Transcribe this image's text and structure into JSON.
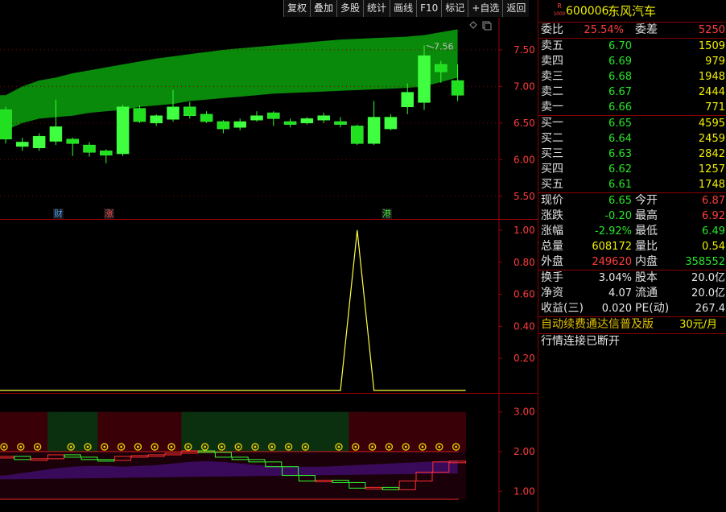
{
  "toolbar": {
    "buttons": [
      "复权",
      "叠加",
      "多股",
      "统计",
      "画线",
      "F10",
      "标记",
      "+自选",
      "返回"
    ]
  },
  "stock": {
    "badge_top": "R",
    "badge_bottom": "1000",
    "code": "600006",
    "name": "东风汽车"
  },
  "quote": {
    "weibi_label": "委比",
    "weibi": "25.54%",
    "weicha_label": "委差",
    "weicha": "5250",
    "asks": [
      {
        "label": "卖五",
        "price": "6.70",
        "vol": "1509"
      },
      {
        "label": "卖四",
        "price": "6.69",
        "vol": "979"
      },
      {
        "label": "卖三",
        "price": "6.68",
        "vol": "1948"
      },
      {
        "label": "卖二",
        "price": "6.67",
        "vol": "2444"
      },
      {
        "label": "卖一",
        "price": "6.66",
        "vol": "771"
      }
    ],
    "bids": [
      {
        "label": "买一",
        "price": "6.65",
        "vol": "4595"
      },
      {
        "label": "买二",
        "price": "6.64",
        "vol": "2459"
      },
      {
        "label": "买三",
        "price": "6.63",
        "vol": "2842"
      },
      {
        "label": "买四",
        "price": "6.62",
        "vol": "1257"
      },
      {
        "label": "买五",
        "price": "6.61",
        "vol": "1748"
      }
    ],
    "stats": [
      {
        "l1": "现价",
        "v1": "6.65",
        "c1": "green",
        "l2": "今开",
        "v2": "6.87",
        "c2": "red"
      },
      {
        "l1": "涨跌",
        "v1": "-0.20",
        "c1": "green",
        "l2": "最高",
        "v2": "6.92",
        "c2": "red"
      },
      {
        "l1": "涨幅",
        "v1": "-2.92%",
        "c1": "green",
        "l2": "最低",
        "v2": "6.49",
        "c2": "green"
      },
      {
        "l1": "总量",
        "v1": "608172",
        "c1": "yellow",
        "l2": "量比",
        "v2": "0.54",
        "c2": "yellow"
      },
      {
        "l1": "外盘",
        "v1": "249620",
        "c1": "red",
        "l2": "内盘",
        "v2": "358552",
        "c2": "green"
      }
    ],
    "finance": [
      {
        "l1": "换手",
        "v1": "3.04%",
        "l2": "股本",
        "v2": "20.0亿"
      },
      {
        "l1": "净资",
        "v1": "4.07",
        "l2": "流通",
        "v2": "20.0亿"
      },
      {
        "l1": "收益(三)",
        "v1": "0.020",
        "l2": "PE(动)",
        "v2": "267.4"
      }
    ],
    "promo_text": "自动续费通达信普及版",
    "promo_price": "30元/月",
    "status": "行情连接已断开"
  },
  "chart_tags": [
    {
      "text": "财",
      "color": "#4aa0ff"
    },
    {
      "text": "涨",
      "color": "#ff5050"
    },
    {
      "text": "港",
      "color": "#40e040"
    }
  ],
  "chart_data": [
    {
      "type": "candlestick",
      "title": "",
      "ylim": [
        5.3,
        7.85
      ],
      "yticks": [
        "7.50",
        "7.00",
        "6.50",
        "6.00",
        "5.50"
      ],
      "annotation": "7.56",
      "candles": [
        {
          "o": 6.68,
          "c": 6.28,
          "h": 6.72,
          "l": 6.22
        },
        {
          "o": 6.18,
          "c": 6.24,
          "h": 6.3,
          "l": 6.12
        },
        {
          "o": 6.16,
          "c": 6.32,
          "h": 6.36,
          "l": 6.12
        },
        {
          "o": 6.25,
          "c": 6.45,
          "h": 6.82,
          "l": 6.2
        },
        {
          "o": 6.28,
          "c": 6.22,
          "h": 6.3,
          "l": 6.05
        },
        {
          "o": 6.2,
          "c": 6.1,
          "h": 6.24,
          "l": 6.04
        },
        {
          "o": 6.12,
          "c": 6.06,
          "h": 6.14,
          "l": 5.95
        },
        {
          "o": 6.08,
          "c": 6.72,
          "h": 6.75,
          "l": 6.05
        },
        {
          "o": 6.7,
          "c": 6.52,
          "h": 6.74,
          "l": 6.5
        },
        {
          "o": 6.5,
          "c": 6.6,
          "h": 6.62,
          "l": 6.46
        },
        {
          "o": 6.55,
          "c": 6.72,
          "h": 6.95,
          "l": 6.52
        },
        {
          "o": 6.72,
          "c": 6.6,
          "h": 6.79,
          "l": 6.56
        },
        {
          "o": 6.62,
          "c": 6.52,
          "h": 6.66,
          "l": 6.5
        },
        {
          "o": 6.52,
          "c": 6.42,
          "h": 6.54,
          "l": 6.36
        },
        {
          "o": 6.44,
          "c": 6.52,
          "h": 6.56,
          "l": 6.4
        },
        {
          "o": 6.54,
          "c": 6.6,
          "h": 6.66,
          "l": 6.52
        },
        {
          "o": 6.64,
          "c": 6.56,
          "h": 6.66,
          "l": 6.46
        },
        {
          "o": 6.52,
          "c": 6.48,
          "h": 6.56,
          "l": 6.44
        },
        {
          "o": 6.5,
          "c": 6.56,
          "h": 6.58,
          "l": 6.48
        },
        {
          "o": 6.54,
          "c": 6.6,
          "h": 6.64,
          "l": 6.5
        },
        {
          "o": 6.52,
          "c": 6.48,
          "h": 6.58,
          "l": 6.44
        },
        {
          "o": 6.46,
          "c": 6.22,
          "h": 6.48,
          "l": 6.2
        },
        {
          "o": 6.22,
          "c": 6.58,
          "h": 6.8,
          "l": 6.2
        },
        {
          "o": 6.42,
          "c": 6.58,
          "h": 6.62,
          "l": 6.4
        },
        {
          "o": 6.72,
          "c": 6.92,
          "h": 7.04,
          "l": 6.62
        },
        {
          "o": 6.78,
          "c": 7.42,
          "h": 7.56,
          "l": 6.68
        },
        {
          "o": 7.3,
          "c": 7.2,
          "h": 7.35,
          "l": 7.05
        },
        {
          "o": 7.08,
          "c": 6.88,
          "h": 7.3,
          "l": 6.8
        }
      ],
      "band_upper": [
        6.88,
        7.0,
        7.08,
        7.12,
        7.18,
        7.22,
        7.26,
        7.3,
        7.34,
        7.38,
        7.41,
        7.44,
        7.47,
        7.5,
        7.52,
        7.54,
        7.56,
        7.58,
        7.6,
        7.62,
        7.64,
        7.65,
        7.66,
        7.67,
        7.68,
        7.7,
        7.74,
        7.78
      ],
      "band_lower": [
        6.4,
        6.5,
        6.56,
        6.58,
        6.6,
        6.64,
        6.66,
        6.68,
        6.72,
        6.74,
        6.76,
        6.8,
        6.82,
        6.84,
        6.86,
        6.88,
        6.9,
        6.91,
        6.92,
        6.93,
        6.94,
        6.95,
        6.96,
        6.97,
        6.98,
        7.0,
        7.06,
        7.12
      ]
    },
    {
      "type": "line",
      "ylim": [
        0,
        1.05
      ],
      "yticks": [
        "1.00",
        "0.80",
        "0.60",
        "0.40",
        "0.20"
      ],
      "values": [
        0,
        0,
        0,
        0,
        0,
        0,
        0,
        0,
        0,
        0,
        0,
        0,
        0,
        0,
        0,
        0,
        0,
        0,
        0,
        0,
        0,
        1,
        0,
        0,
        0,
        0,
        0,
        0
      ],
      "color": "#ffff40"
    },
    {
      "type": "indicator",
      "ylim": [
        0.6,
        3.4
      ],
      "yticks": [
        "3.00",
        "2.00",
        "1.00"
      ],
      "hlines": [
        2.0,
        0.8
      ],
      "dots": [
        1,
        1,
        1,
        0,
        1,
        1,
        1,
        1,
        1,
        1,
        1,
        1,
        1,
        1,
        1,
        1,
        1,
        1,
        1,
        0,
        1,
        1,
        1,
        1,
        1,
        1,
        1,
        1
      ],
      "step_line": [
        1.88,
        1.8,
        1.82,
        1.92,
        1.86,
        1.8,
        1.78,
        1.88,
        1.9,
        1.92,
        1.96,
        2.02,
        1.98,
        1.86,
        1.8,
        1.74,
        1.62,
        1.4,
        1.26,
        1.28,
        1.22,
        1.08,
        1.1,
        1.04,
        1.26,
        1.48,
        1.74,
        1.76
      ],
      "trend_line": [
        1.4,
        1.46,
        1.52,
        1.58,
        1.62,
        1.64,
        1.64,
        1.62,
        1.64,
        1.66,
        1.7,
        1.74,
        1.76,
        1.74,
        1.7,
        1.66,
        1.64,
        1.62,
        1.62,
        1.62,
        1.64,
        1.66,
        1.68,
        1.7,
        1.72,
        1.74,
        1.76,
        1.78
      ]
    }
  ]
}
